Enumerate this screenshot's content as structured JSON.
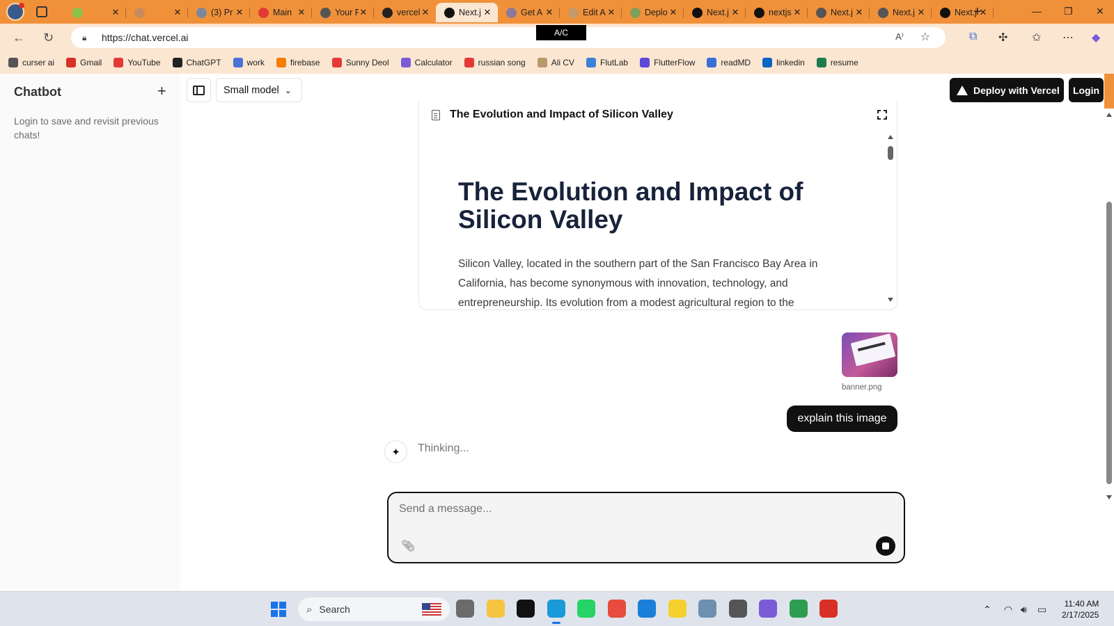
{
  "browser": {
    "tabs": [
      {
        "title": "",
        "favicon": "lock-icon",
        "color": "#8bc34a"
      },
      {
        "title": "",
        "favicon": "globe-icon",
        "color": "#c98a5a"
      },
      {
        "title": "(3) Pr",
        "favicon": "linkedin-icon",
        "color": "#7a8899"
      },
      {
        "title": "Main",
        "favicon": "youtube-icon",
        "color": "#e53935"
      },
      {
        "title": "Your F",
        "favicon": "github-icon",
        "color": "#555555"
      },
      {
        "title": "vercel",
        "favicon": "github-icon",
        "color": "#222222"
      },
      {
        "title": "Next.j",
        "favicon": "next-icon",
        "color": "#111111"
      },
      {
        "title": "Get A",
        "favicon": "gallery-icon",
        "color": "#8a7a9a"
      },
      {
        "title": "Edit A",
        "favicon": "vs-icon",
        "color": "#c49a6c"
      },
      {
        "title": "Deplo",
        "favicon": "deploy-icon",
        "color": "#7fa05a"
      },
      {
        "title": "Next.j",
        "favicon": "next-icon",
        "color": "#111111"
      },
      {
        "title": "nextjs",
        "favicon": "vercel-icon",
        "color": "#111111"
      },
      {
        "title": "Next.j",
        "favicon": "next-icon",
        "color": "#555555"
      },
      {
        "title": "Next.j",
        "favicon": "next-icon",
        "color": "#555555"
      },
      {
        "title": "Next.j",
        "favicon": "next-icon",
        "color": "#111111"
      }
    ],
    "active_tab_index": 6,
    "url": "https://chat.vercel.ai",
    "tooltip": "A/C",
    "bookmarks": [
      {
        "label": "curser ai",
        "color": "#555555"
      },
      {
        "label": "Gmail",
        "color": "#d93025"
      },
      {
        "label": "YouTube",
        "color": "#e53935"
      },
      {
        "label": "ChatGPT",
        "color": "#222222"
      },
      {
        "label": "work",
        "color": "#4a72d8"
      },
      {
        "label": "firebase",
        "color": "#f57c00"
      },
      {
        "label": "Sunny Deol",
        "color": "#e53935"
      },
      {
        "label": "Calculator",
        "color": "#7b5cd6"
      },
      {
        "label": "russian song",
        "color": "#e53935"
      },
      {
        "label": "Ali CV",
        "color": "#b89a6a"
      },
      {
        "label": "FlutLab",
        "color": "#3b82d6"
      },
      {
        "label": "FlutterFlow",
        "color": "#5b4ad8"
      },
      {
        "label": "readMD",
        "color": "#3b6fd8"
      },
      {
        "label": "linkedin",
        "color": "#0a66c2"
      },
      {
        "label": "resume",
        "color": "#1e7b4f"
      }
    ]
  },
  "sidebar": {
    "title": "Chatbot",
    "note": "Login to save and revisit previous chats!"
  },
  "header": {
    "model_label": "Small model",
    "deploy_label": "Deploy with Vercel",
    "login_label": "Login"
  },
  "artifact": {
    "header_title": "The Evolution and Impact of Silicon Valley",
    "heading": "The Evolution and Impact of Silicon Valley",
    "paragraph": "Silicon Valley, located in the southern part of the San Francisco Bay Area in California, has become synonymous with innovation, technology, and entrepreneurship. Its evolution from a modest agricultural region to the"
  },
  "chat": {
    "attachment_name": "banner.png",
    "user_message": "explain this image",
    "status": "Thinking..."
  },
  "composer": {
    "placeholder": "Send a message..."
  },
  "taskbar": {
    "search_label": "Search",
    "time": "11:40 AM",
    "date": "2/17/2025",
    "apps": [
      {
        "name": "files-app",
        "color": "#6b6b6b"
      },
      {
        "name": "explorer-app",
        "color": "#f5c542"
      },
      {
        "name": "terminal-app",
        "color": "#111111"
      },
      {
        "name": "edge-app",
        "color": "#1a9ad8"
      },
      {
        "name": "whatsapp-app",
        "color": "#25d366"
      },
      {
        "name": "git-app",
        "color": "#e74c3c"
      },
      {
        "name": "vscode-app",
        "color": "#1a7fd8"
      },
      {
        "name": "postman-app",
        "color": "#f5d02e"
      },
      {
        "name": "monitor-app",
        "color": "#6d8fb0"
      },
      {
        "name": "clock-app",
        "color": "#555555"
      },
      {
        "name": "visual-studio-app",
        "color": "#7b5cd6"
      },
      {
        "name": "chrome-dev-app",
        "color": "#2e9d4f"
      },
      {
        "name": "chrome-app",
        "color": "#d93025"
      }
    ]
  }
}
